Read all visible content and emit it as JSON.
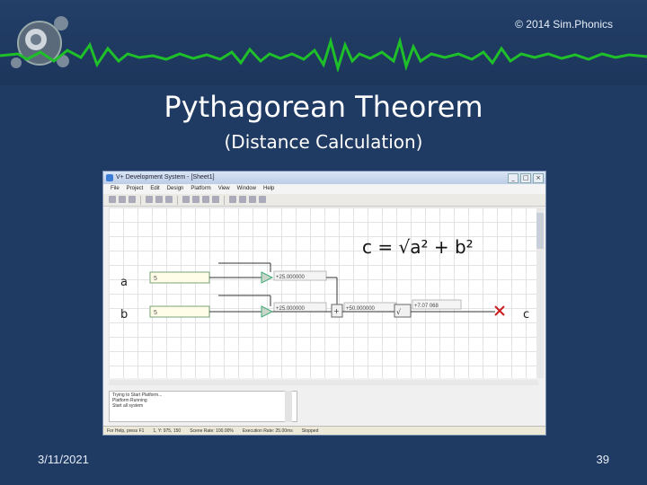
{
  "slide": {
    "copyright": "© 2014 Sim.Phonics",
    "title": "Pythagorean Theorem",
    "subtitle": "(Distance Calculation)",
    "date": "3/11/2021",
    "page_number": "39"
  },
  "window": {
    "title": "V+ Development System - [Sheet1]",
    "menu": [
      "File",
      "Project",
      "Edit",
      "Design",
      "Platform",
      "View",
      "Window",
      "Help"
    ],
    "log_lines": [
      "Trying to Start Platform...",
      "Platform Running",
      "Start all system"
    ],
    "status": [
      "For Help, press F1",
      "1, Y: 975, 150",
      "Scene Rate: 100.00%",
      "Execution Rate: 25.00ms",
      "Stopped"
    ]
  },
  "diagram": {
    "formula": "c = √a² + b²",
    "label_a": "a",
    "label_b": "b",
    "label_c": "c",
    "input_a_value": "5",
    "input_b_value": "5",
    "square_a_value": "+25.000000",
    "square_b_value": "+25.000000",
    "sum_value": "+50.000000",
    "sqrt_value": "+7.07 068"
  },
  "colors": {
    "background": "#1f3a63",
    "waveform": "#1fbf2a",
    "output_marker": "#cc1e1e"
  }
}
